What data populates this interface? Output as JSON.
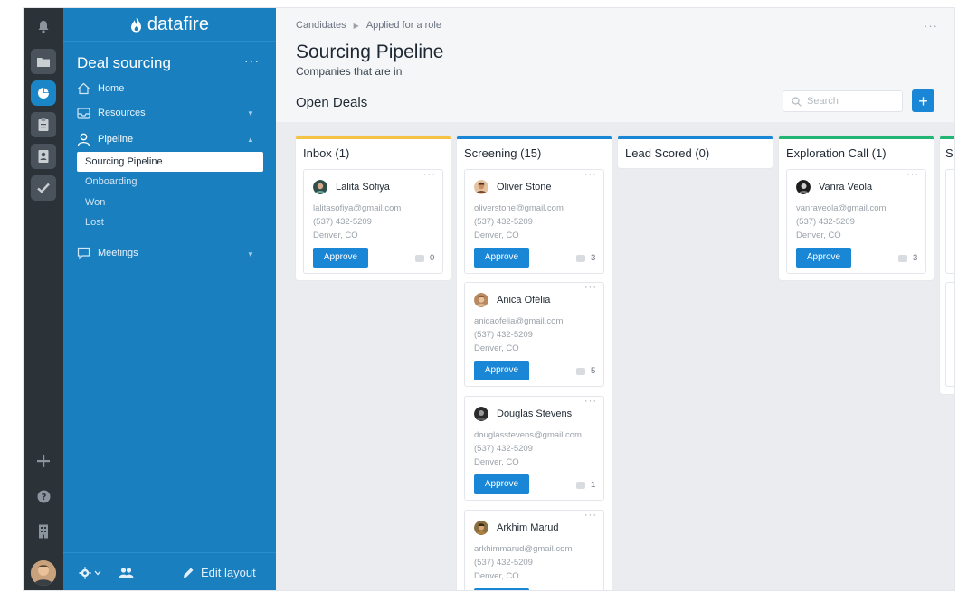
{
  "rail": {
    "icons": [
      "bell-icon",
      "folder-icon",
      "pie-chart-icon",
      "clipboard-icon",
      "contact-card-icon",
      "checkmark-icon",
      "plus-icon",
      "help-icon",
      "building-icon"
    ]
  },
  "sidebar": {
    "brand": "datafire",
    "workspace_title": "Deal sourcing",
    "more": "···",
    "nav": {
      "home": "Home",
      "resources": "Resources",
      "pipeline": "Pipeline",
      "meetings": "Meetings"
    },
    "pipeline_items": [
      "Sourcing Pipeline",
      "Onboarding",
      "Won",
      "Lost"
    ],
    "footer": {
      "edit_layout": "Edit layout"
    }
  },
  "header": {
    "breadcrumbs": [
      "Candidates",
      "Applied for a role"
    ],
    "more": "···",
    "title": "Sourcing Pipeline",
    "subtitle": "Companies that are in",
    "section_title": "Open Deals",
    "search_placeholder": "Search",
    "add_label": "+"
  },
  "colors": {
    "inbox": "#f5c343",
    "screening": "#1a86d6",
    "lead_scored": "#1a86d6",
    "exploration": "#22b573",
    "accent": "#1a86d6",
    "sidebar": "#1a7fbf"
  },
  "board": {
    "approve_label": "Approve",
    "card_more": "···",
    "columns": [
      {
        "title": "Inbox (1)",
        "cards": [
          {
            "name": "Lalita Sofiya",
            "email": "lalitasofiya@gmail.com",
            "phone": "(537) 432-5209",
            "location": "Denver, CO",
            "comments": "0"
          }
        ]
      },
      {
        "title": "Screening (15)",
        "cards": [
          {
            "name": "Oliver Stone",
            "email": "oliverstone@gmail.com",
            "phone": "(537) 432-5209",
            "location": "Denver, CO",
            "comments": "3"
          },
          {
            "name": "Anica Ofélia",
            "email": "anicaofelia@gmail.com",
            "phone": "(537) 432-5209",
            "location": "Denver, CO",
            "comments": "5"
          },
          {
            "name": "Douglas Stevens",
            "email": "douglasstevens@gmail.com",
            "phone": "(537) 432-5209",
            "location": "Denver, CO",
            "comments": "1"
          },
          {
            "name": "Arkhim Marud",
            "email": "arkhimmarud@gmail.com",
            "phone": "(537) 432-5209",
            "location": "Denver, CO",
            "comments": ""
          }
        ]
      },
      {
        "title": "Lead Scored (0)",
        "cards": []
      },
      {
        "title": "Exploration Call (1)",
        "cards": [
          {
            "name": "Vanra Veola",
            "email": "vanraveola@gmail.com",
            "phone": "(537) 432-5209",
            "location": "Denver, CO",
            "comments": "3"
          }
        ]
      },
      {
        "title": "S",
        "cards": []
      }
    ]
  }
}
